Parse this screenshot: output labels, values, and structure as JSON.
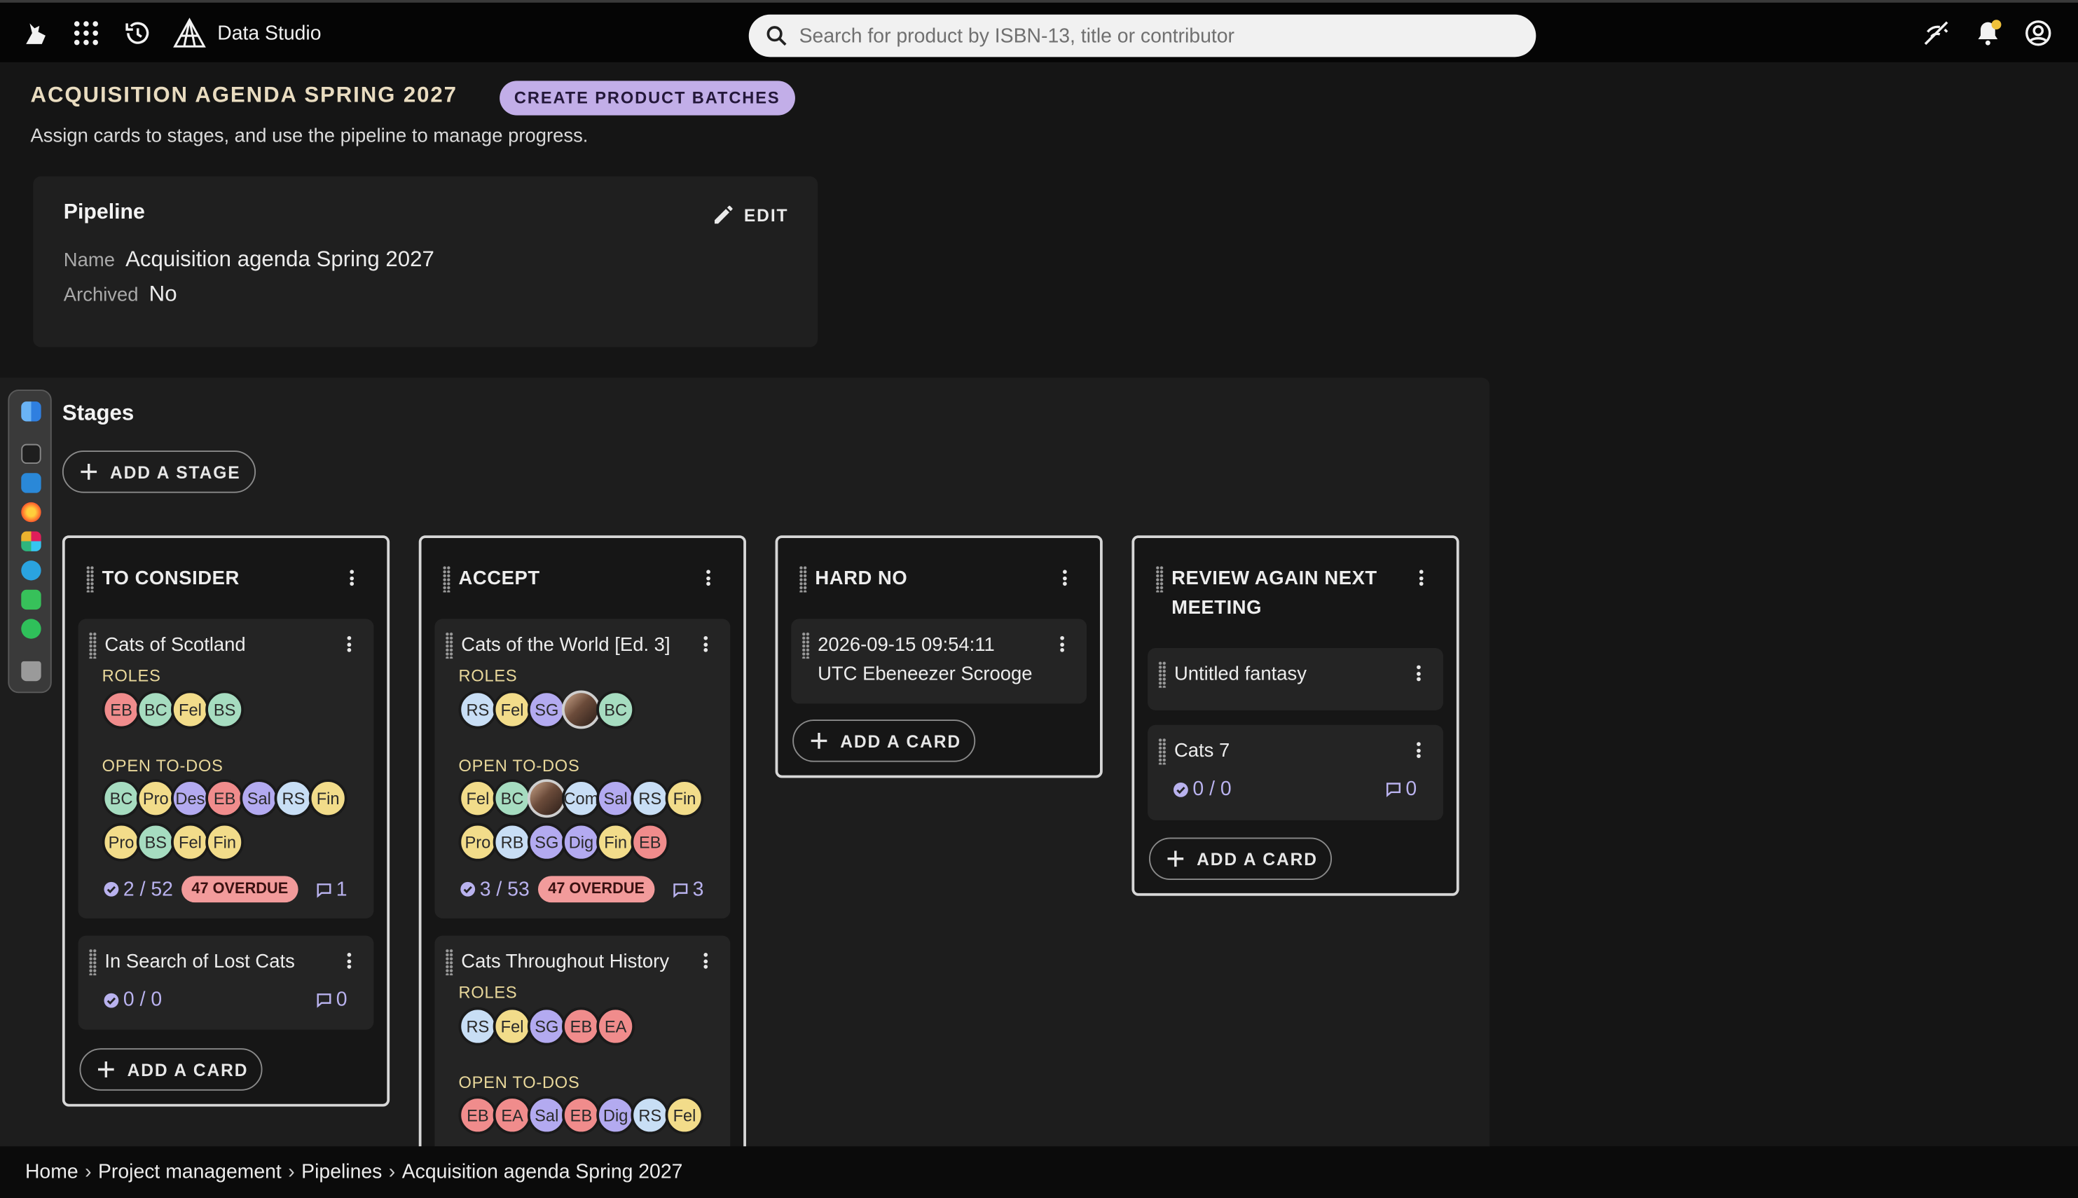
{
  "header": {
    "app_title": "Data Studio",
    "search_placeholder": "Search for product by ISBN-13, title or contributor",
    "icons": [
      "cat-logo-icon",
      "apps-grid-icon",
      "history-icon",
      "data-studio-logo-icon",
      "search-icon",
      "offline-icon",
      "notifications-bell-icon",
      "account-icon"
    ]
  },
  "page": {
    "title": "ACQUISITION AGENDA SPRING 2027",
    "create_batches_label": "CREATE PRODUCT BATCHES",
    "subtitle": "Assign cards to stages, and use the pipeline to manage progress."
  },
  "pipeline": {
    "heading": "Pipeline",
    "edit_label": "EDIT",
    "name_label": "Name",
    "name_value": "Acquisition agenda Spring 2027",
    "archived_label": "Archived",
    "archived_value": "No"
  },
  "stages": {
    "heading": "Stages",
    "add_stage_label": "ADD A STAGE",
    "add_card_label": "ADD A CARD",
    "roles_label": "ROLES",
    "todos_label": "OPEN TO-DOS",
    "columns": [
      {
        "title": "TO CONSIDER",
        "cards": [
          {
            "title": "Cats of Scotland",
            "roles": [
              "EB",
              "BC",
              "Fel",
              "BS"
            ],
            "todos": [
              "BC",
              "Pro",
              "Des",
              "EB",
              "Sal",
              "RS",
              "Fin",
              "Pro",
              "BS",
              "Fel",
              "Fin"
            ],
            "done": "2 / 52",
            "overdue": "47 OVERDUE",
            "comments": "1"
          },
          {
            "title": "In Search of Lost Cats",
            "done": "0 / 0",
            "comments": "0"
          }
        ]
      },
      {
        "title": "ACCEPT",
        "cards": [
          {
            "title": "Cats of the World [Ed. 3]",
            "roles": [
              "RS",
              "Fel",
              "SG",
              "photo",
              "BC"
            ],
            "todos": [
              "Fel",
              "BC",
              "photo",
              "Com",
              "Sal",
              "RS",
              "Fin",
              "Pro",
              "RB",
              "SG",
              "Dig",
              "Fin",
              "EB"
            ],
            "done": "3 / 53",
            "overdue": "47 OVERDUE",
            "comments": "3"
          },
          {
            "title": "Cats Throughout History",
            "roles": [
              "RS",
              "Fel",
              "SG",
              "EB",
              "EA"
            ],
            "todos": [
              "EB",
              "EA",
              "Sal",
              "EB",
              "Dig",
              "RS",
              "Fel"
            ]
          }
        ]
      },
      {
        "title": "HARD NO",
        "cards": [
          {
            "title_line1": "2026-09-15 09:54:11",
            "title_line2": "UTC Ebeneezer Scrooge"
          }
        ]
      },
      {
        "title_line1": "REVIEW AGAIN NEXT",
        "title_line2": "MEETING",
        "cards": [
          {
            "title": "Untitled fantasy"
          },
          {
            "title": "Cats 7",
            "done": "0 / 0",
            "comments": "0"
          }
        ]
      }
    ]
  },
  "avatar_colors": {
    "EB": "#f08c8c",
    "BC": "#a6dcc0",
    "Fel": "#f2dc8a",
    "BS": "#a6dcc0",
    "RS": "#c8def5",
    "SG": "#b3aaf0",
    "Pro": "#f2dc8a",
    "Des": "#b3aaf0",
    "Sal": "#b3aaf0",
    "Fin": "#f2dc8a",
    "Com": "#c8def5",
    "RB": "#c8def5",
    "Dig": "#b3aaf0",
    "EA": "#f08c8c"
  },
  "breadcrumb": [
    "Home",
    "Project management",
    "Pipelines",
    "Acquisition agenda Spring 2027"
  ],
  "dock_apps": [
    "finder-icon",
    "terminal-icon",
    "vscode-icon",
    "firefox-icon",
    "slack-icon",
    "telegram-icon",
    "facetime-icon",
    "whatsapp-icon",
    "trash-icon"
  ]
}
